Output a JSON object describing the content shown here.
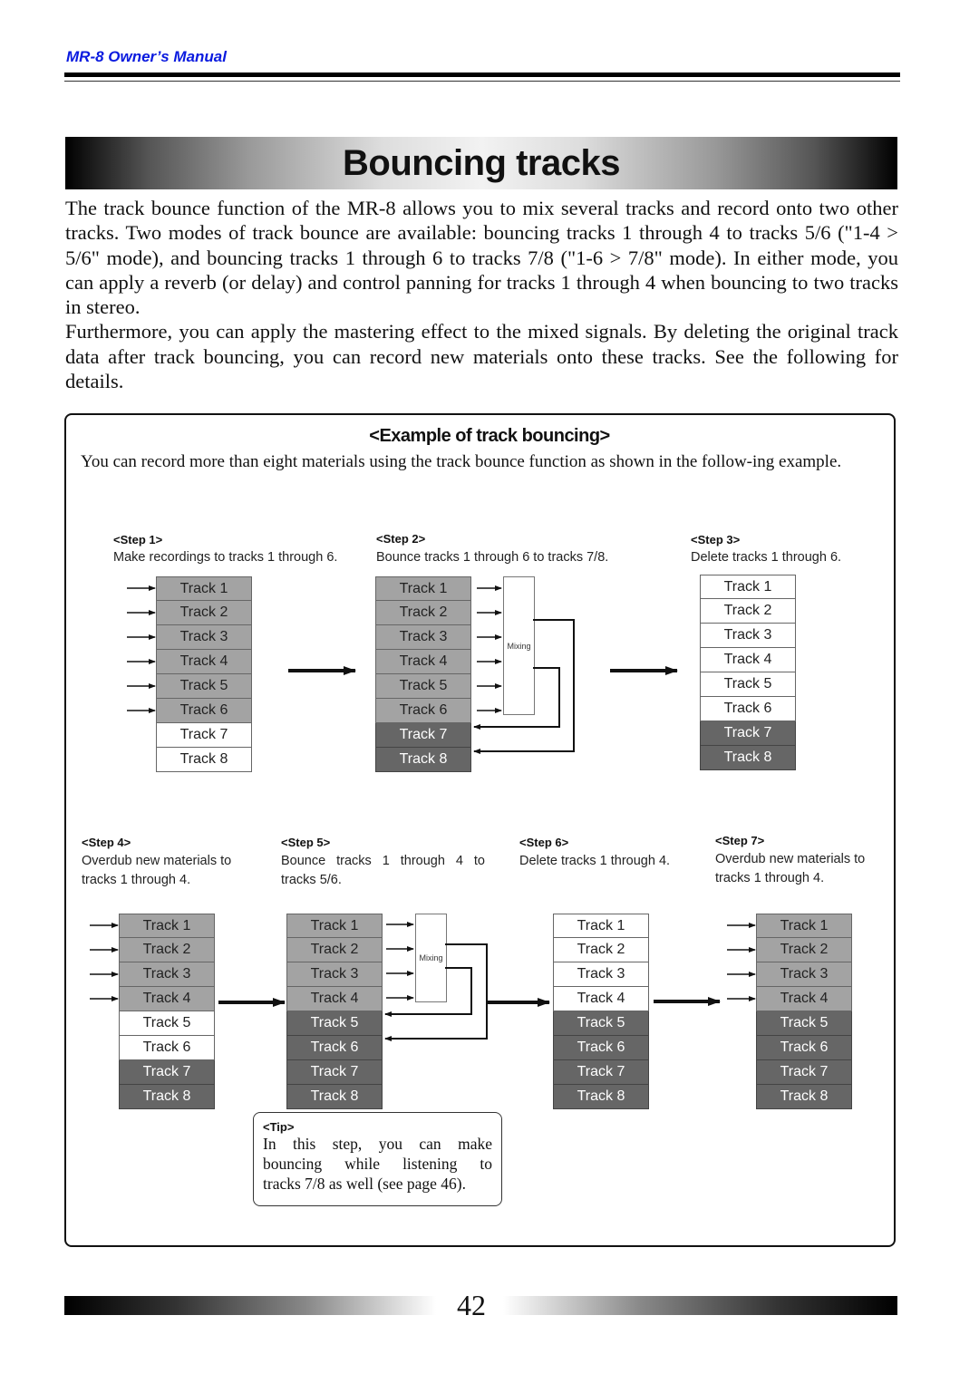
{
  "header": {
    "manual_title": "MR-8 Owner’s Manual"
  },
  "page_title": "Bouncing tracks",
  "intro": {
    "paragraphs": [
      "The track bounce function of the MR-8 allows you to mix several tracks and record onto two other tracks.  Two modes of track bounce are available: bouncing tracks 1 through 4 to tracks 5/6 (\"1-4 > 5/6\" mode), and bouncing tracks 1 through 6 to tracks 7/8 (\"1-6 > 7/8\" mode).  In either mode, you can apply a reverb (or delay) and control panning for tracks 1 through 4 when bouncing to two tracks in stereo.",
      "Furthermore, you can apply the mastering effect to the mixed signals.  By deleting the original track data after track bouncing, you can record new materials onto these tracks. See the following for details."
    ]
  },
  "example": {
    "title": "<Example of track bouncing>",
    "description": "You can record more than eight materials using the track bounce function as shown in the follow-ing example.",
    "mixing_label": "Mixing",
    "steps": [
      {
        "label": "<Step 1>",
        "desc": "Make recordings to tracks 1 through 6.",
        "tracks": [
          {
            "name": "Track 1",
            "state": "rec"
          },
          {
            "name": "Track 2",
            "state": "rec"
          },
          {
            "name": "Track 3",
            "state": "rec"
          },
          {
            "name": "Track 4",
            "state": "rec"
          },
          {
            "name": "Track 5",
            "state": "rec"
          },
          {
            "name": "Track 6",
            "state": "rec"
          },
          {
            "name": "Track 7",
            "state": "empty"
          },
          {
            "name": "Track 8",
            "state": "empty"
          }
        ]
      },
      {
        "label": "<Step 2>",
        "desc": "Bounce tracks 1 through 6 to tracks 7/8.",
        "tracks": [
          {
            "name": "Track 1",
            "state": "rec"
          },
          {
            "name": "Track 2",
            "state": "rec"
          },
          {
            "name": "Track 3",
            "state": "rec"
          },
          {
            "name": "Track 4",
            "state": "rec"
          },
          {
            "name": "Track 5",
            "state": "rec"
          },
          {
            "name": "Track 6",
            "state": "rec"
          },
          {
            "name": "Track 7",
            "state": "full"
          },
          {
            "name": "Track 8",
            "state": "full"
          }
        ]
      },
      {
        "label": "<Step 3>",
        "desc": "Delete tracks 1 through 6.",
        "tracks": [
          {
            "name": "Track 1",
            "state": "empty"
          },
          {
            "name": "Track 2",
            "state": "empty"
          },
          {
            "name": "Track 3",
            "state": "empty"
          },
          {
            "name": "Track 4",
            "state": "empty"
          },
          {
            "name": "Track 5",
            "state": "empty"
          },
          {
            "name": "Track 6",
            "state": "empty"
          },
          {
            "name": "Track 7",
            "state": "full"
          },
          {
            "name": "Track 8",
            "state": "full"
          }
        ]
      },
      {
        "label": "<Step 4>",
        "desc_lines": [
          "Overdub new materials to",
          "tracks 1 through 4."
        ],
        "tracks": [
          {
            "name": "Track 1",
            "state": "rec"
          },
          {
            "name": "Track 2",
            "state": "rec"
          },
          {
            "name": "Track 3",
            "state": "rec"
          },
          {
            "name": "Track 4",
            "state": "rec"
          },
          {
            "name": "Track 5",
            "state": "empty"
          },
          {
            "name": "Track 6",
            "state": "empty"
          },
          {
            "name": "Track 7",
            "state": "full"
          },
          {
            "name": "Track 8",
            "state": "full"
          }
        ]
      },
      {
        "label": "<Step 5>",
        "desc_lines": [
          "Bounce tracks 1 through 4 to",
          "tracks 5/6."
        ],
        "tracks": [
          {
            "name": "Track 1",
            "state": "rec"
          },
          {
            "name": "Track 2",
            "state": "rec"
          },
          {
            "name": "Track 3",
            "state": "rec"
          },
          {
            "name": "Track 4",
            "state": "rec"
          },
          {
            "name": "Track 5",
            "state": "full"
          },
          {
            "name": "Track 6",
            "state": "full"
          },
          {
            "name": "Track 7",
            "state": "full"
          },
          {
            "name": "Track 8",
            "state": "full"
          }
        ]
      },
      {
        "label": "<Step 6>",
        "desc": "Delete tracks 1 through 4.",
        "tracks": [
          {
            "name": "Track 1",
            "state": "empty"
          },
          {
            "name": "Track 2",
            "state": "empty"
          },
          {
            "name": "Track 3",
            "state": "empty"
          },
          {
            "name": "Track 4",
            "state": "empty"
          },
          {
            "name": "Track 5",
            "state": "full"
          },
          {
            "name": "Track 6",
            "state": "full"
          },
          {
            "name": "Track 7",
            "state": "full"
          },
          {
            "name": "Track 8",
            "state": "full"
          }
        ]
      },
      {
        "label": "<Step 7>",
        "desc_lines": [
          "Overdub new materials to",
          "tracks 1 through 4."
        ],
        "tracks": [
          {
            "name": "Track 1",
            "state": "rec"
          },
          {
            "name": "Track 2",
            "state": "rec"
          },
          {
            "name": "Track 3",
            "state": "rec"
          },
          {
            "name": "Track 4",
            "state": "rec"
          },
          {
            "name": "Track 5",
            "state": "full"
          },
          {
            "name": "Track 6",
            "state": "full"
          },
          {
            "name": "Track 7",
            "state": "full"
          },
          {
            "name": "Track 8",
            "state": "full"
          }
        ]
      }
    ],
    "tip": {
      "label": "<Tip>",
      "lines": [
        "In this step, you can make",
        "bouncing while listening to",
        "tracks 7/8 as well (see page 46)."
      ]
    }
  },
  "footer": {
    "page_number": "42"
  }
}
